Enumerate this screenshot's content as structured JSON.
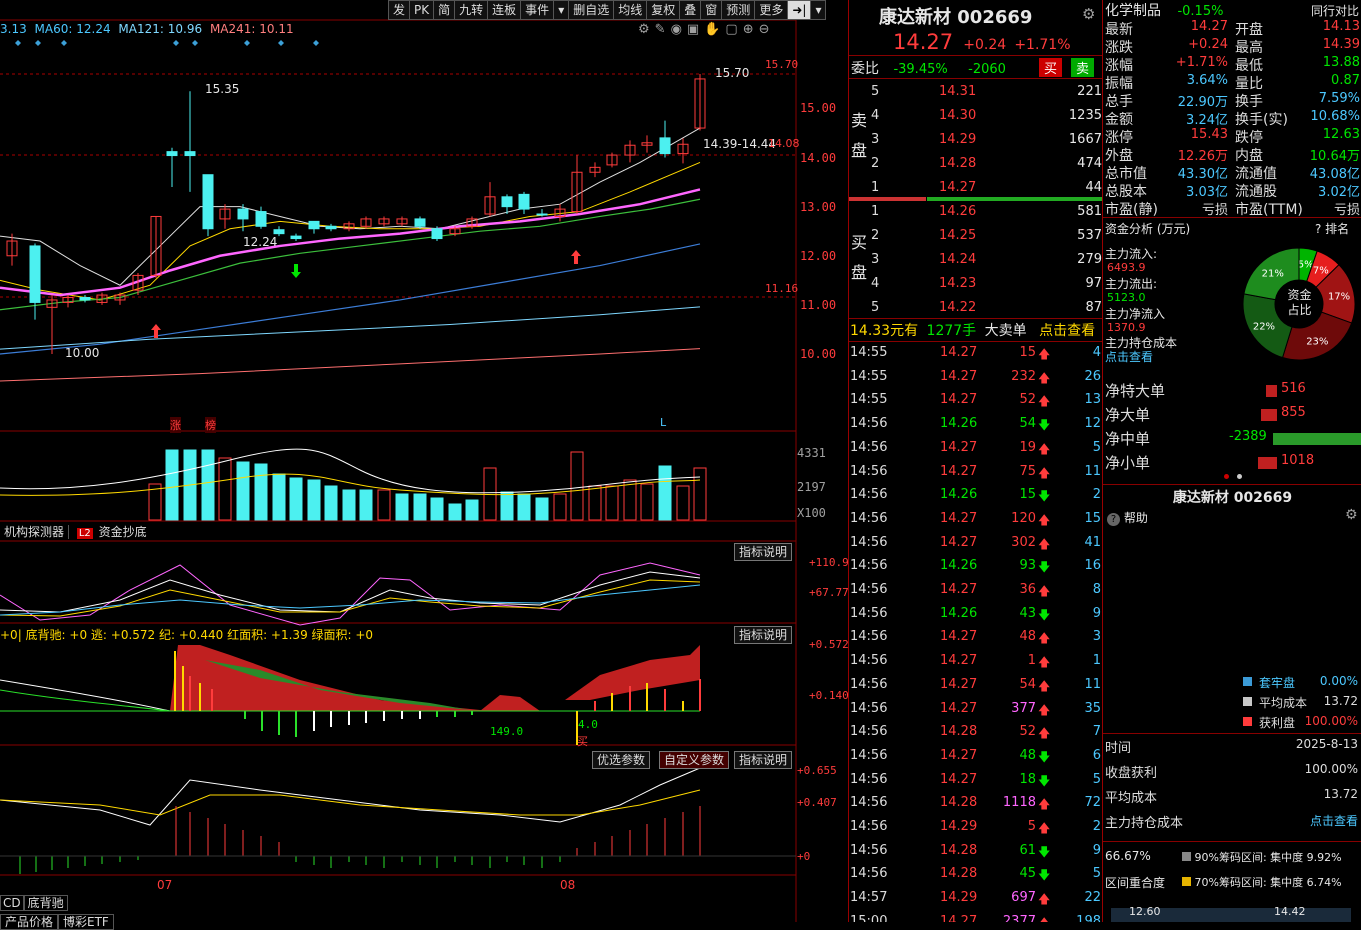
{
  "toolbar": {
    "buttons": [
      "发",
      "PK",
      "简",
      "九转",
      "连板",
      "事件",
      "▾",
      "删自选",
      "均线",
      "复权",
      "叠",
      "窗",
      "预测",
      "更多",
      "➜|",
      "▾"
    ]
  },
  "ma_legend": [
    {
      "label": "3.13",
      "color": "#4cc8ff"
    },
    {
      "label": "MA60: 12.24",
      "color": "#4cc8ff"
    },
    {
      "label": "MA121: 10.96",
      "color": "#7fd8ff"
    },
    {
      "label": "MA241: 10.11",
      "color": "#ff7f7f"
    }
  ],
  "price_axis": [
    "15.70",
    "15.00",
    "14.00",
    "13.00",
    "12.00",
    "11.16",
    "11.00",
    "10.00"
  ],
  "price_annotations": {
    "high1": "15.35",
    "low1": "12.24",
    "low2": "10.00",
    "high2": "15.70",
    "range": "14.39-14.44",
    "last": "14.08"
  },
  "markers": {
    "zhang": "涨",
    "bang": "榜",
    "L": "L"
  },
  "vol_axis": [
    "4331",
    "2197",
    "X100"
  ],
  "tabs": {
    "tab1": "机构探测器",
    "tab2_badge": "L2",
    "tab2": "资金抄底"
  },
  "osc1": {
    "btn": "指标说明",
    "v1": "+110.9",
    "v2": "+67.77"
  },
  "osc2": {
    "legend": "+0| 底背驰: +0  逃: +0.572  纪: +0.440  红面积: +1.39  绿面积: +0",
    "btn": "指标说明",
    "v1": "+0.572",
    "v2": "+0.140",
    "ann1": "149.0",
    "ann2": "4.0",
    "ann3": "买"
  },
  "osc3": {
    "btn1": "优选参数",
    "btn2": "自定义参数",
    "btn3": "指标说明",
    "v1": "+0.655",
    "v2": "+0.407",
    "v3": "+0"
  },
  "xaxis": [
    "07",
    "08"
  ],
  "bottom_tabs": [
    "CD",
    "底背驰",
    "产品价格",
    "博彩ETF"
  ],
  "stock": {
    "name": "康达新材",
    "code": "002669",
    "price": "14.27",
    "change": "+0.24",
    "pct": "+1.71%"
  },
  "ratio": {
    "label": "委比",
    "pct": "-39.45%",
    "val": "-2060",
    "buy": "买",
    "sell": "卖"
  },
  "sell_side": "卖盘",
  "buy_side": "买盘",
  "asks": [
    {
      "n": "5",
      "p": "14.31",
      "v": "221"
    },
    {
      "n": "4",
      "p": "14.30",
      "v": "1235"
    },
    {
      "n": "3",
      "p": "14.29",
      "v": "1667"
    },
    {
      "n": "2",
      "p": "14.28",
      "v": "474"
    },
    {
      "n": "1",
      "p": "14.27",
      "v": "44"
    }
  ],
  "bids": [
    {
      "n": "1",
      "p": "14.26",
      "v": "581"
    },
    {
      "n": "2",
      "p": "14.25",
      "v": "537"
    },
    {
      "n": "3",
      "p": "14.24",
      "v": "279"
    },
    {
      "n": "4",
      "p": "14.23",
      "v": "97"
    },
    {
      "n": "5",
      "p": "14.22",
      "v": "87"
    }
  ],
  "bigorder": {
    "amt": "14.33元有",
    "hands": "1277手",
    "label": "大卖单",
    "link": "点击查看"
  },
  "ticks": [
    {
      "t": "14:55",
      "p": "14.27",
      "v": "15",
      "d": "up",
      "n": "4"
    },
    {
      "t": "14:55",
      "p": "14.27",
      "v": "232",
      "d": "up",
      "n": "26"
    },
    {
      "t": "14:55",
      "p": "14.27",
      "v": "52",
      "d": "up",
      "n": "13"
    },
    {
      "t": "14:56",
      "p": "14.26",
      "v": "54",
      "d": "down",
      "n": "12"
    },
    {
      "t": "14:56",
      "p": "14.27",
      "v": "19",
      "d": "up",
      "n": "5"
    },
    {
      "t": "14:56",
      "p": "14.27",
      "v": "75",
      "d": "up",
      "n": "11"
    },
    {
      "t": "14:56",
      "p": "14.26",
      "v": "15",
      "d": "down",
      "n": "2"
    },
    {
      "t": "14:56",
      "p": "14.27",
      "v": "120",
      "d": "up",
      "n": "15"
    },
    {
      "t": "14:56",
      "p": "14.27",
      "v": "302",
      "d": "up",
      "n": "41"
    },
    {
      "t": "14:56",
      "p": "14.26",
      "v": "93",
      "d": "down",
      "n": "16"
    },
    {
      "t": "14:56",
      "p": "14.27",
      "v": "36",
      "d": "up",
      "n": "8"
    },
    {
      "t": "14:56",
      "p": "14.26",
      "v": "43",
      "d": "down",
      "n": "9"
    },
    {
      "t": "14:56",
      "p": "14.27",
      "v": "48",
      "d": "up",
      "n": "3"
    },
    {
      "t": "14:56",
      "p": "14.27",
      "v": "1",
      "d": "up",
      "n": "1"
    },
    {
      "t": "14:56",
      "p": "14.27",
      "v": "54",
      "d": "up",
      "n": "11"
    },
    {
      "t": "14:56",
      "p": "14.27",
      "v": "377",
      "d": "up",
      "n": "35",
      "big": true
    },
    {
      "t": "14:56",
      "p": "14.28",
      "v": "52",
      "d": "up",
      "n": "7"
    },
    {
      "t": "14:56",
      "p": "14.27",
      "v": "48",
      "d": "down",
      "n": "6"
    },
    {
      "t": "14:56",
      "p": "14.27",
      "v": "18",
      "d": "down",
      "n": "5"
    },
    {
      "t": "14:56",
      "p": "14.28",
      "v": "1118",
      "d": "up",
      "n": "72",
      "big": true
    },
    {
      "t": "14:56",
      "p": "14.29",
      "v": "5",
      "d": "up",
      "n": "2"
    },
    {
      "t": "14:56",
      "p": "14.28",
      "v": "61",
      "d": "down",
      "n": "9"
    },
    {
      "t": "14:56",
      "p": "14.28",
      "v": "45",
      "d": "down",
      "n": "5"
    },
    {
      "t": "14:57",
      "p": "14.29",
      "v": "697",
      "d": "up",
      "n": "22",
      "big": true
    },
    {
      "t": "15:00",
      "p": "14.27",
      "v": "2377",
      "d": "up",
      "n": "198",
      "big": true
    }
  ],
  "sector": {
    "name": "化学制品",
    "pct": "-0.15%",
    "compare": "同行对比"
  },
  "quote": [
    [
      "最新",
      "14.27",
      "开盘",
      "14.13"
    ],
    [
      "涨跌",
      "+0.24",
      "最高",
      "14.39"
    ],
    [
      "涨幅",
      "+1.71%",
      "最低",
      "13.88"
    ],
    [
      "振幅",
      "3.64%",
      "量比",
      "0.87"
    ],
    [
      "总手",
      "22.90万",
      "换手",
      "7.59%"
    ],
    [
      "金额",
      "3.24亿",
      "换手(实)",
      "10.68%"
    ],
    [
      "涨停",
      "15.43",
      "跌停",
      "12.63"
    ],
    [
      "外盘",
      "12.26万",
      "内盘",
      "10.64万"
    ],
    [
      "总市值",
      "43.30亿",
      "流通值",
      "43.08亿"
    ],
    [
      "总股本",
      "3.03亿",
      "流通股",
      "3.02亿"
    ],
    [
      "市盈(静)",
      "亏损",
      "市盈(TTM)",
      "亏损"
    ]
  ],
  "funds": {
    "title": "资金分析 (万元)",
    "rank": "?  排名",
    "inflow_l": "主力流入:",
    "inflow": "6493.9",
    "outflow_l": "主力流出:",
    "outflow": "5123.0",
    "net_l": "主力净流入",
    "net": "1370.9",
    "cost_l": "主力持仓成本",
    "link": "点击查看",
    "donut": "资金占比",
    "pie": [
      {
        "label": "5%",
        "v": 5,
        "color": "#00b400"
      },
      {
        "label": "7%",
        "v": 7,
        "color": "#e61e1e"
      },
      {
        "label": "17%",
        "v": 17,
        "color": "#a01414"
      },
      {
        "label": "23%",
        "v": 23,
        "color": "#6e0a0a"
      },
      {
        "label": "22%",
        "v": 22,
        "color": "#145a14"
      },
      {
        "label": "21%",
        "v": 21,
        "color": "#1e8c1e"
      }
    ]
  },
  "flows": [
    {
      "label": "净特大单",
      "v": "516",
      "n": 516
    },
    {
      "label": "净大单",
      "v": "855",
      "n": 855
    },
    {
      "label": "净中单",
      "v": "-2389",
      "n": -2389
    },
    {
      "label": "净小单",
      "v": "1018",
      "n": 1018
    }
  ],
  "chip": {
    "title": "康达新材 002669",
    "help": "帮助",
    "legend": [
      {
        "label": "套牢盘",
        "v": "0.00%",
        "color": "#3c9bd7"
      },
      {
        "label": "平均成本",
        "v": "13.72",
        "color": "#c8c8c8"
      },
      {
        "label": "获利盘",
        "v": "100.00%",
        "color": "#ff3c3c"
      }
    ],
    "rows": [
      [
        "时间",
        "2025-8-13"
      ],
      [
        "收盘获利",
        "100.00%"
      ],
      [
        "平均成本",
        "13.72"
      ],
      [
        "主力持仓成本",
        "点击查看"
      ]
    ],
    "conc": "66.67%",
    "c90": "90%筹码区间: 集中度",
    "c90v": "9.92%",
    "conc_l": "区间重合度",
    "c70": "70%筹码区间: 集中度",
    "c70v": "6.74%",
    "lo": "12.60",
    "hi": "14.42"
  }
}
